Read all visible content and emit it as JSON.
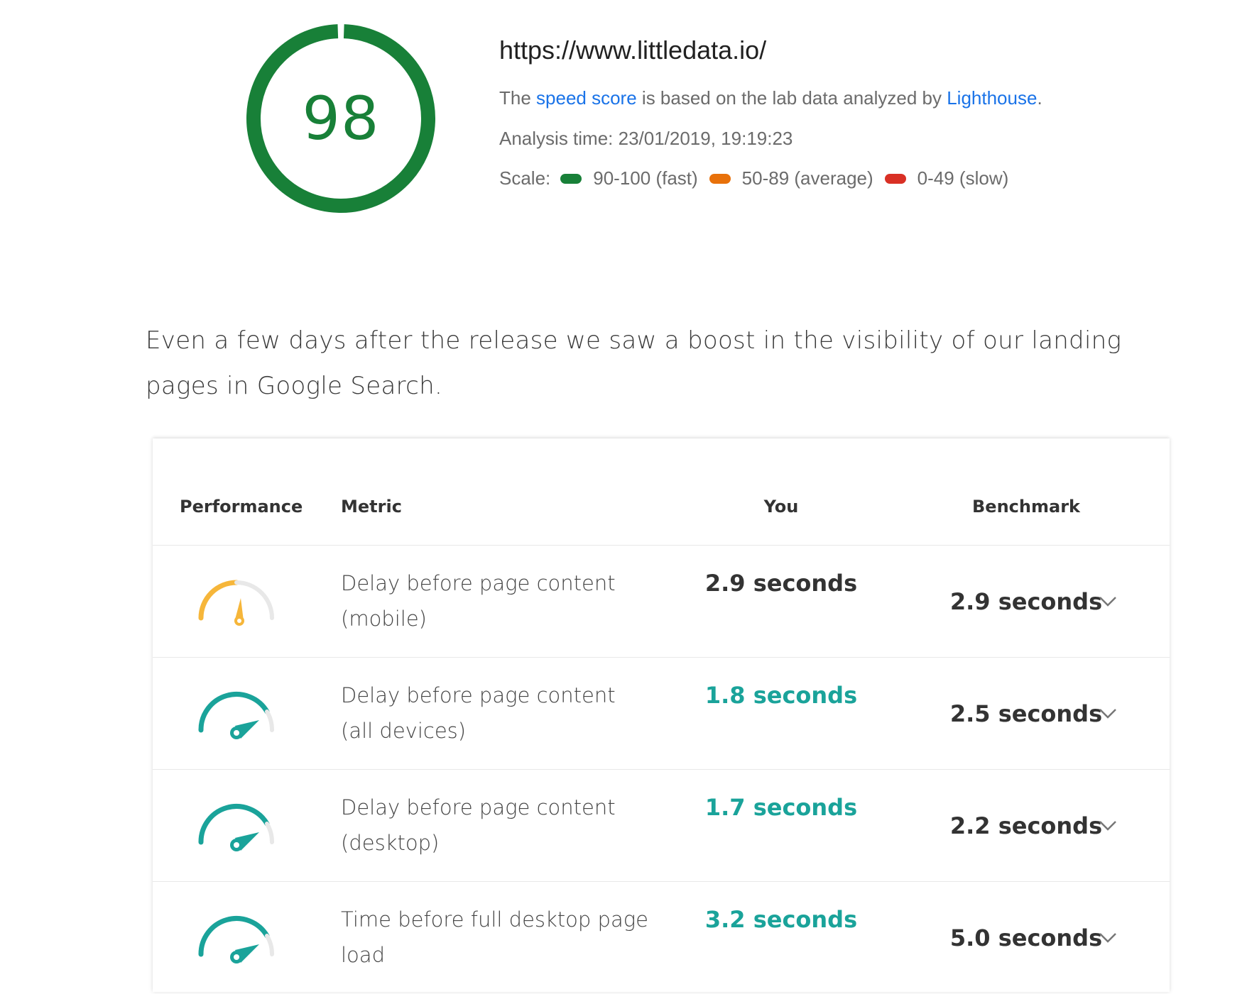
{
  "score": {
    "value": "98",
    "color": "#188038"
  },
  "site": {
    "url": "https://www.littledata.io/"
  },
  "lighthouse_line": {
    "prefix": "The ",
    "speed_score_link": "speed score",
    "middle": " is based on the lab data analyzed by ",
    "lighthouse_link": "Lighthouse",
    "suffix": "."
  },
  "analysis_time": "Analysis time: 23/01/2019, 19:19:23",
  "scale": {
    "label": "Scale:",
    "items": [
      {
        "color": "#188038",
        "label": "90-100 (fast)"
      },
      {
        "color": "#e8710a",
        "label": "50-89 (average)"
      },
      {
        "color": "#d93025",
        "label": "0-49 (slow)"
      }
    ]
  },
  "intro_text": "Even a few days after the release we saw a boost in the visibility of our landing pages in Google Search.",
  "table": {
    "headers": {
      "performance": "Performance",
      "metric": "Metric",
      "you": "You",
      "benchmark": "Benchmark"
    },
    "rows": [
      {
        "gauge_icon": "speedometer-average-icon",
        "gauge_color": "#f6b63a",
        "metric": "Delay before page content (mobile)",
        "you": "2.9 seconds",
        "you_status": "neutral",
        "benchmark": "2.9 seconds"
      },
      {
        "gauge_icon": "speedometer-fast-icon",
        "gauge_color": "#1aa39a",
        "metric": "Delay before page content (all devices)",
        "you": "1.8 seconds",
        "you_status": "good",
        "benchmark": "2.5 seconds"
      },
      {
        "gauge_icon": "speedometer-fast-icon",
        "gauge_color": "#1aa39a",
        "metric": "Delay before page content (desktop)",
        "you": "1.7 seconds",
        "you_status": "good",
        "benchmark": "2.2 seconds"
      },
      {
        "gauge_icon": "speedometer-fast-icon",
        "gauge_color": "#1aa39a",
        "metric": "Time before full desktop page load",
        "you": "3.2 seconds",
        "you_status": "good",
        "benchmark": "5.0 seconds"
      }
    ]
  },
  "colors": {
    "link": "#1a73e8",
    "good": "#1aa39a",
    "average": "#f6b63a"
  }
}
